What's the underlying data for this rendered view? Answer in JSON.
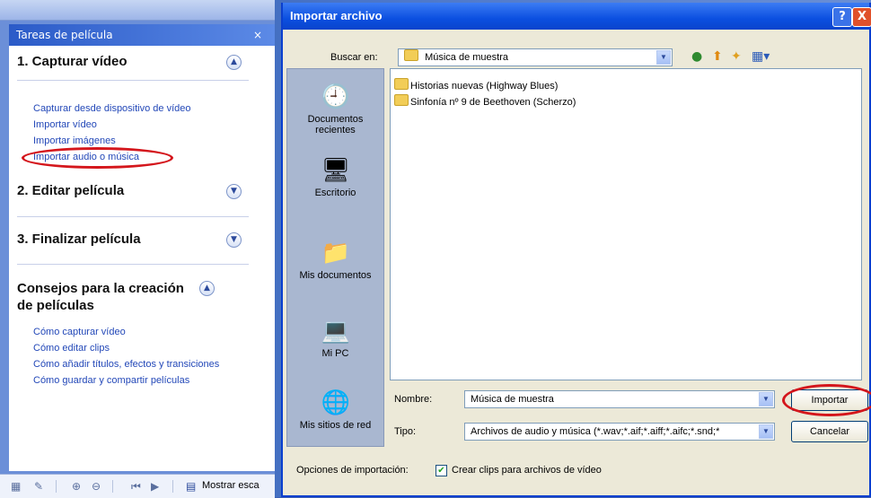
{
  "task_pane": {
    "header": "Tareas de película",
    "close_glyph": "×",
    "sections": [
      {
        "title": "1. Capturar vídeo",
        "chevron": "up",
        "links": [
          "Capturar desde dispositivo de vídeo",
          "Importar vídeo",
          "Importar imágenes",
          "Importar audio o música"
        ]
      },
      {
        "title": "2. Editar película",
        "chevron": "down"
      },
      {
        "title": "3. Finalizar película",
        "chevron": "down"
      },
      {
        "title_line1": "Consejos para la creación",
        "title_line2": "de películas",
        "chevron": "up",
        "links": [
          "Cómo capturar vídeo",
          "Cómo editar clips",
          "Cómo añadir títulos, efectos y transiciones",
          "Cómo guardar y compartir películas"
        ]
      }
    ],
    "toolbar_text": "Mostrar esca"
  },
  "dialog": {
    "title": "Importar archivo",
    "help_glyph": "?",
    "close_glyph": "X",
    "look_in_label": "Buscar en:",
    "look_in_value": "Música de muestra",
    "places": [
      "Documentos recientes",
      "Escritorio",
      "Mis documentos",
      "Mi PC",
      "Mis sitios de red"
    ],
    "files": [
      "Historias nuevas (Highway Blues)",
      "Sinfonía nº 9 de Beethoven (Scherzo)"
    ],
    "name_label": "Nombre:",
    "name_value": "Música de muestra",
    "type_label": "Tipo:",
    "type_value": "Archivos de audio y música (*.wav;*.aif;*.aiff;*.aifc;*.snd;*",
    "import_button": "Importar",
    "cancel_button": "Cancelar",
    "options_label": "Opciones de importación:",
    "options_checkbox_label": "Crear clips para archivos de vídeo",
    "options_checked": true
  },
  "colors": {
    "accent": "#0b4fe0",
    "link": "#2348b8",
    "highlight_oval": "#d4161c"
  }
}
